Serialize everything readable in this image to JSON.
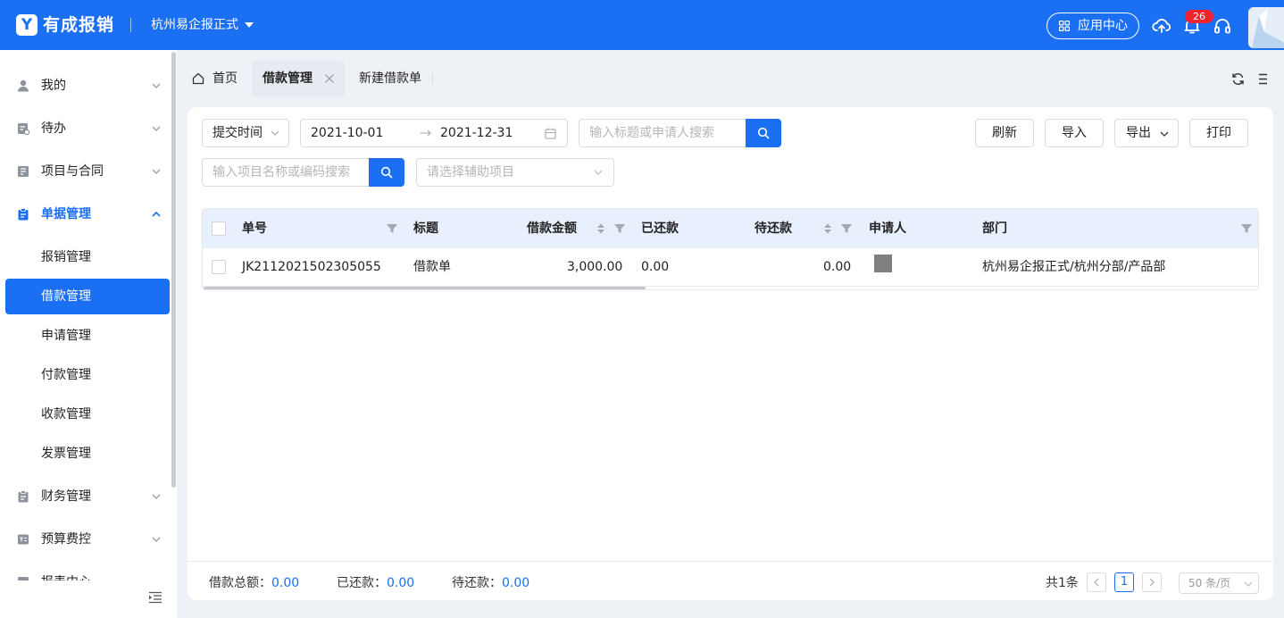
{
  "header": {
    "logo_glyph": "Y",
    "brand": "有成报销",
    "company": "杭州易企报正式",
    "app_center": "应用中心",
    "notification_count": "26"
  },
  "sidebar": {
    "items": [
      {
        "label": "我的",
        "icon": "user-icon"
      },
      {
        "label": "待办",
        "icon": "todo-icon"
      },
      {
        "label": "项目与合同",
        "icon": "project-icon"
      },
      {
        "label": "单据管理",
        "icon": "document-icon"
      },
      {
        "label": "财务管理",
        "icon": "finance-icon"
      },
      {
        "label": "预算费控",
        "icon": "budget-icon"
      },
      {
        "label": "报表中心",
        "icon": "report-icon"
      }
    ],
    "sub_items": [
      "报销管理",
      "借款管理",
      "申请管理",
      "付款管理",
      "收款管理",
      "发票管理"
    ]
  },
  "tabs": {
    "home": "首页",
    "loan_mgmt": "借款管理",
    "new_loan": "新建借款单"
  },
  "filters": {
    "time_type": "提交时间",
    "date_start": "2021-10-01",
    "date_end": "2021-12-31",
    "title_search_placeholder": "输入标题或申请人搜索",
    "project_search_placeholder": "输入项目名称或编码搜索",
    "aux_placeholder": "请选择辅助项目"
  },
  "actions": {
    "refresh": "刷新",
    "import": "导入",
    "export": "导出",
    "print": "打印"
  },
  "table": {
    "columns": [
      "单号",
      "标题",
      "借款金额",
      "已还款",
      "待还款",
      "申请人",
      "部门"
    ],
    "rows": [
      {
        "number": "JK2112021502305055",
        "title": "借款单",
        "amount": "3,000.00",
        "repaid": "0.00",
        "pending": "0.00",
        "department": "杭州易企报正式/杭州分部/产品部"
      }
    ]
  },
  "summary": {
    "total_label": "借款总额：",
    "total_value": "0.00",
    "repaid_label": "已还款：",
    "repaid_value": "0.00",
    "pending_label": "待还款：",
    "pending_value": "0.00"
  },
  "pagination": {
    "total": "共1条",
    "current_page": "1",
    "page_size": "50 条/页"
  },
  "colors": {
    "primary": "#1b6ff3",
    "header_bg": "#1b6ff3",
    "badge": "#f5222d",
    "table_head_bg": "#e8f0fd"
  }
}
